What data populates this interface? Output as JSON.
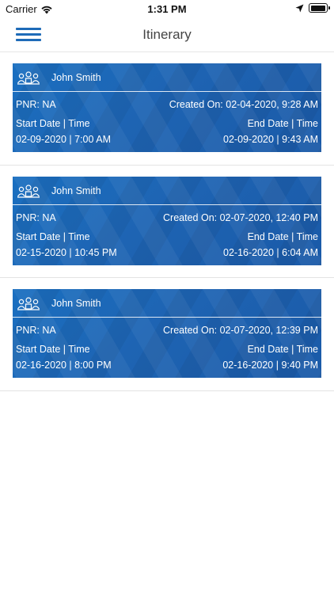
{
  "status_bar": {
    "carrier": "Carrier",
    "time": "1:31 PM"
  },
  "nav": {
    "title": "Itinerary",
    "menu_icon": "hamburger-menu-icon"
  },
  "labels": {
    "start_header": "Start Date | Time",
    "end_header": "End Date | Time"
  },
  "trips": [
    {
      "name": "John Smith",
      "pnr": "PNR: NA",
      "created": "Created On: 02-04-2020, 9:28 AM",
      "start": "02-09-2020 | 7:00 AM",
      "end": "02-09-2020 | 9:43 AM"
    },
    {
      "name": "John Smith",
      "pnr": "PNR: NA",
      "created": "Created On: 02-07-2020, 12:40 PM",
      "start": "02-15-2020 | 10:45 PM",
      "end": "02-16-2020 | 6:04 AM"
    },
    {
      "name": "John Smith",
      "pnr": "PNR: NA",
      "created": "Created On: 02-07-2020, 12:39 PM",
      "start": "02-16-2020 | 8:00 PM",
      "end": "02-16-2020 | 9:40 PM"
    }
  ],
  "colors": {
    "accent": "#1e6bb8",
    "card": "#1a64b4"
  }
}
